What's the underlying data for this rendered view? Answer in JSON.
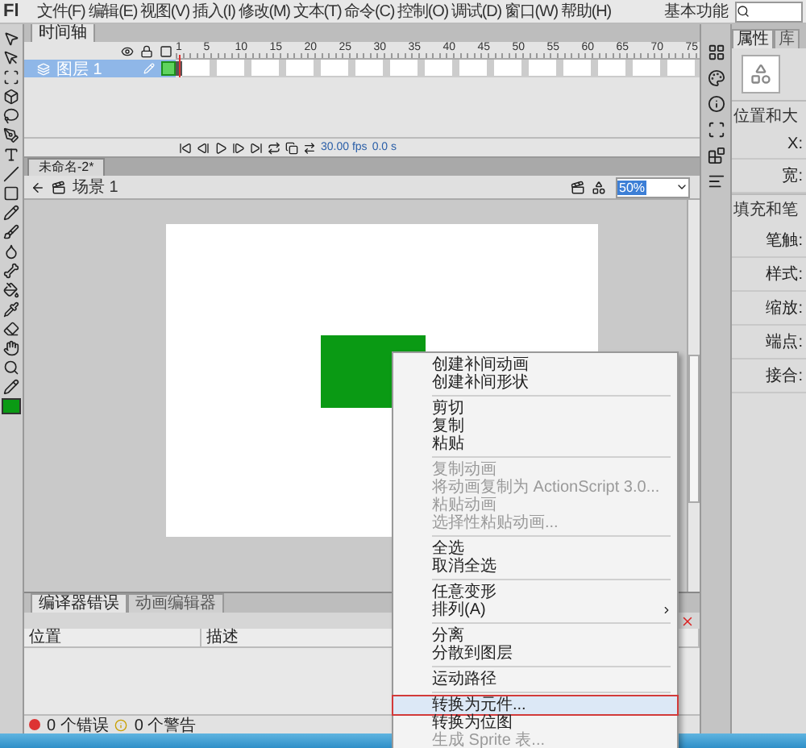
{
  "app": {
    "logo": "Fl",
    "menus": [
      "文件(F)",
      "编辑(E)",
      "视图(V)",
      "插入(I)",
      "修改(M)",
      "文本(T)",
      "命令(C)",
      "控制(O)",
      "调试(D)",
      "窗口(W)",
      "帮助(H)"
    ],
    "workspace": "基本功能"
  },
  "timeline": {
    "tab": "时间轴",
    "frame_numbers": [
      "1",
      "5",
      "10",
      "15",
      "20",
      "25",
      "30",
      "35",
      "40",
      "45",
      "50",
      "55",
      "60",
      "65",
      "70",
      "75"
    ],
    "layers": [
      {
        "name": "图层 1",
        "selected": true
      }
    ],
    "fps": "30.00 fps",
    "time": "0.0 s"
  },
  "document": {
    "tab": "未命名-2*",
    "scene": "场景 1",
    "zoom": "50%"
  },
  "output": {
    "tabs": [
      {
        "label": "编译器错误",
        "selected": true
      },
      {
        "label": "动画编辑器",
        "selected": false
      }
    ],
    "columns": [
      "位置",
      "描述"
    ],
    "errors": "0 个错误",
    "warnings": "0 个警告"
  },
  "properties": {
    "tabs": [
      {
        "label": "属性",
        "selected": true
      },
      {
        "label": "库",
        "selected": false
      }
    ],
    "sections": [
      {
        "title": "位置和大",
        "fields": [
          "X:",
          "宽:"
        ]
      },
      {
        "title": "填充和笔",
        "fields": [
          "笔触:",
          "样式:",
          "缩放:",
          "端点:",
          "接合:"
        ]
      }
    ]
  },
  "context_menu": {
    "groups": [
      [
        {
          "label": "创建补间动画",
          "disabled": false,
          "selected": false,
          "submenu": false
        },
        {
          "label": "创建补间形状",
          "disabled": false,
          "selected": false,
          "submenu": false
        }
      ],
      [
        {
          "label": "剪切",
          "disabled": false,
          "selected": false,
          "submenu": false
        },
        {
          "label": "复制",
          "disabled": false,
          "selected": false,
          "submenu": false
        },
        {
          "label": "粘贴",
          "disabled": false,
          "selected": false,
          "submenu": false
        }
      ],
      [
        {
          "label": "复制动画",
          "disabled": true,
          "selected": false,
          "submenu": false
        },
        {
          "label": "将动画复制为 ActionScript 3.0...",
          "disabled": true,
          "selected": false,
          "submenu": false
        },
        {
          "label": "粘贴动画",
          "disabled": true,
          "selected": false,
          "submenu": false
        },
        {
          "label": "选择性粘贴动画...",
          "disabled": true,
          "selected": false,
          "submenu": false
        }
      ],
      [
        {
          "label": "全选",
          "disabled": false,
          "selected": false,
          "submenu": false
        },
        {
          "label": "取消全选",
          "disabled": false,
          "selected": false,
          "submenu": false
        }
      ],
      [
        {
          "label": "任意变形",
          "disabled": false,
          "selected": false,
          "submenu": false
        },
        {
          "label": "排列(A)",
          "disabled": false,
          "selected": false,
          "submenu": true
        }
      ],
      [
        {
          "label": "分离",
          "disabled": false,
          "selected": false,
          "submenu": false
        },
        {
          "label": "分散到图层",
          "disabled": false,
          "selected": false,
          "submenu": false
        }
      ],
      [
        {
          "label": "运动路径",
          "disabled": false,
          "selected": false,
          "submenu": false
        }
      ],
      [
        {
          "label": "转换为元件...",
          "disabled": false,
          "selected": true,
          "submenu": false
        },
        {
          "label": "转换为位图",
          "disabled": false,
          "selected": false,
          "submenu": false
        },
        {
          "label": "生成 Sprite 表...",
          "disabled": true,
          "selected": false,
          "submenu": false
        }
      ]
    ]
  }
}
